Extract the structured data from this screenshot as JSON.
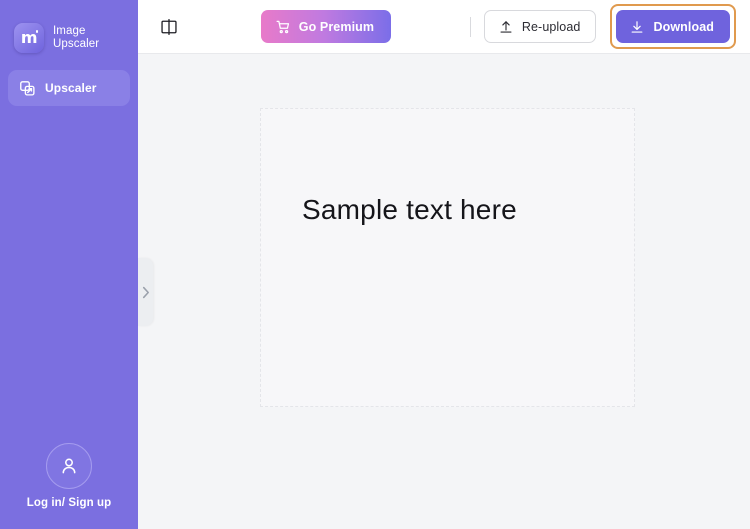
{
  "app": {
    "brand_name_line1": "Image",
    "brand_name_line2": "Upscaler",
    "brand_logo_letter": "m",
    "accent_purple": "#7b6fe0",
    "accent_orange_highlight": "#e09a4e",
    "download_purple": "#6f63dd",
    "premium_gradient_from": "#e87ac9",
    "premium_gradient_to": "#7b6ee8",
    "canvas_background": "#f4f5f7"
  },
  "sidebar": {
    "items": [
      {
        "label": "Upscaler",
        "icon": "upscale-image-icon",
        "active": true
      }
    ],
    "user": {
      "label": "Log in/ Sign up",
      "icon": "user-avatar-icon"
    },
    "expand_handle_icon": "chevron-right-icon"
  },
  "toolbar": {
    "compare_icon": "split-compare-icon",
    "premium_label": "Go Premium",
    "premium_icon": "shopping-cart-icon",
    "reupload_label": "Re-upload",
    "reupload_icon": "upload-arrow-icon",
    "download_label": "Download",
    "download_icon": "download-arrow-icon",
    "download_highlighted": true
  },
  "canvas": {
    "image_text": "Sample text here"
  }
}
